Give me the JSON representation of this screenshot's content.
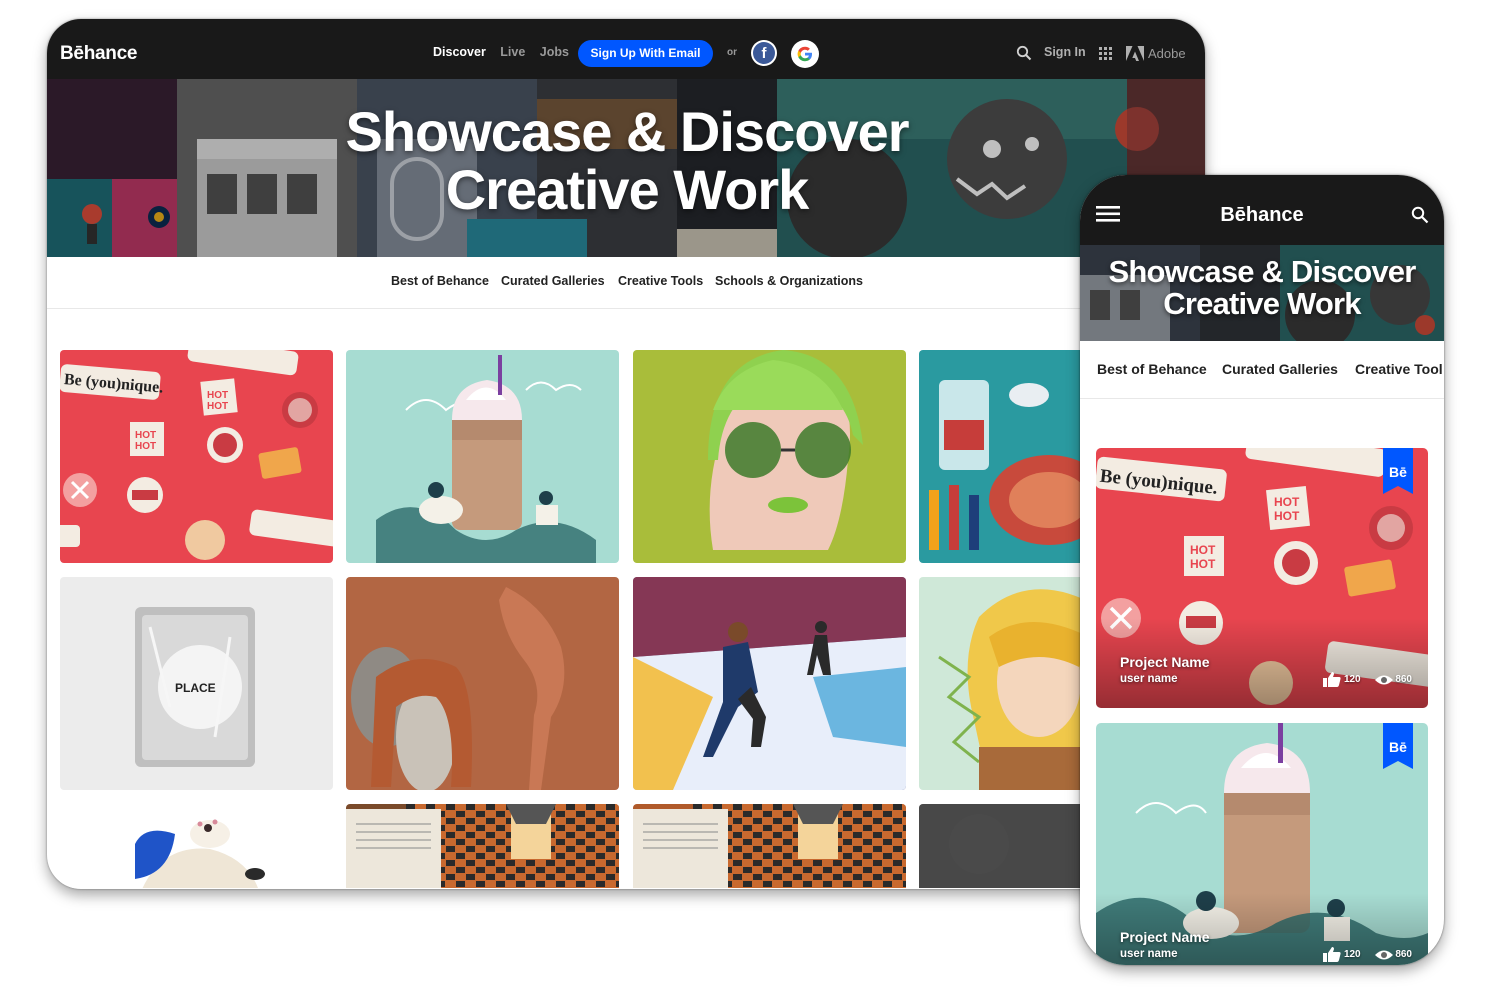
{
  "desktop": {
    "header": {
      "logo": "Bēhance",
      "nav": [
        {
          "label": "Discover",
          "active": true
        },
        {
          "label": "Live",
          "active": false
        },
        {
          "label": "Jobs",
          "active": false
        }
      ],
      "signup_label": "Sign Up With Email",
      "or_label": "or",
      "facebook_glyph": "f",
      "signin_label": "Sign In",
      "adobe_label": "Adobe"
    },
    "hero": {
      "title_line1": "Showcase & Discover",
      "title_line2": "Creative Work"
    },
    "subnav": [
      "Best of Behance",
      "Curated Galleries",
      "Creative Tools",
      "Schools & Organizations"
    ],
    "tiles": [
      {
        "name": "be-younique-stickers",
        "sticker_text": "Be (you)nique."
      },
      {
        "name": "frappe-illustration"
      },
      {
        "name": "green-glasses-portrait"
      },
      {
        "name": "lab-bottle-illustration"
      },
      {
        "name": "foil-package",
        "package_text": "PLACE"
      },
      {
        "name": "sculpture-render"
      },
      {
        "name": "runner-illustration"
      },
      {
        "name": "blonde-portrait"
      },
      {
        "name": "dog-photo"
      },
      {
        "name": "book-spread-1"
      },
      {
        "name": "book-spread-2"
      },
      {
        "name": "dark-texture"
      }
    ]
  },
  "mobile": {
    "header": {
      "logo": "Bēhance"
    },
    "hero": {
      "title_line1": "Showcase & Discover",
      "title_line2": "Creative Work"
    },
    "subnav": [
      "Best of Behance",
      "Curated Galleries",
      "Creative Tool"
    ],
    "cards": [
      {
        "project_name": "Project Name",
        "user_name": "user name",
        "likes": "120",
        "views": "860",
        "badge": "Bē"
      },
      {
        "project_name": "Project Name",
        "user_name": "user name",
        "likes": "120",
        "views": "860",
        "badge": "Bē"
      }
    ]
  },
  "colors": {
    "header_bg": "#191919",
    "signup_blue": "#0057ff",
    "facebook_blue": "#3b5998",
    "badge_blue": "#0057ff"
  },
  "icons": [
    "search-icon",
    "apps-grid-icon",
    "adobe-logo-icon",
    "hamburger-menu-icon",
    "thumbs-up-icon",
    "eye-icon",
    "facebook-icon",
    "google-icon",
    "behance-badge-icon"
  ]
}
